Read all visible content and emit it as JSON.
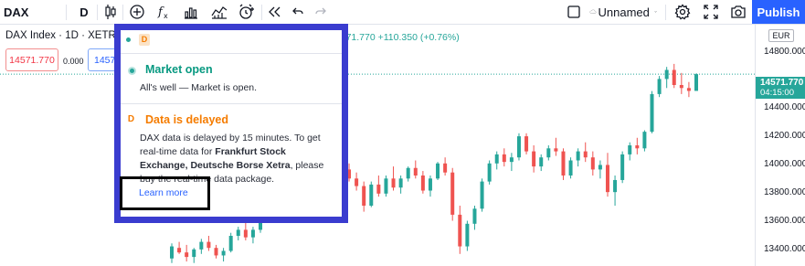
{
  "toolbar": {
    "symbol": "DAX",
    "interval": "D",
    "items": [
      "bar-style",
      "compare-add",
      "indicators",
      "financials",
      "templates",
      "alert",
      "replay",
      "undo",
      "redo"
    ],
    "layout_name": "Unnamed",
    "publish_label": "Publish"
  },
  "legend": {
    "title": "DAX Index · 1D · XETR",
    "ohlc": "O14519.720 H14576.600 L14511.300 C14571.770 +110.350 (+0.76%)",
    "sell_price": "14571.770",
    "spread": "0.000",
    "buy_price": "14571.770"
  },
  "popup": {
    "interval_badge": "D",
    "market": {
      "title": "Market open",
      "text": "All's well — Market is open."
    },
    "delay": {
      "badge": "D",
      "title": "Data is delayed",
      "text_pre": "DAX data is delayed by 15 minutes. To get real-time data for ",
      "text_bold": "Frankfurt Stock Exchange, Deutsche Borse Xetra",
      "text_post": ", please buy the real-time data package.",
      "link": "Learn more"
    }
  },
  "price_scale": {
    "currency": "EUR",
    "ticks": [
      "14800.000",
      "14400.000",
      "14200.000",
      "14000.000",
      "13800.000",
      "13600.000",
      "13400.000"
    ],
    "last_price": "14571.770",
    "countdown": "04:15:00"
  },
  "colors": {
    "up": "#26a69a",
    "down": "#ef5350",
    "accent": "#2962ff",
    "highlight_frame": "#3a3ccf"
  },
  "chart_data": {
    "type": "candlestick",
    "ylim": [
      13300,
      14900
    ],
    "candles": [
      [
        13350,
        13450,
        13320,
        13430
      ],
      [
        13420,
        13460,
        13380,
        13390
      ],
      [
        13390,
        13440,
        13330,
        13360
      ],
      [
        13360,
        13420,
        13320,
        13410
      ],
      [
        13410,
        13480,
        13380,
        13460
      ],
      [
        13460,
        13500,
        13400,
        13420
      ],
      [
        13420,
        13440,
        13350,
        13370
      ],
      [
        13370,
        13420,
        13330,
        13400
      ],
      [
        13400,
        13520,
        13390,
        13500
      ],
      [
        13500,
        13560,
        13470,
        13540
      ],
      [
        13540,
        13600,
        13470,
        13490
      ],
      [
        13490,
        13560,
        13450,
        13540
      ],
      [
        13540,
        13700,
        13520,
        13680
      ],
      [
        13680,
        13720,
        13600,
        13620
      ],
      [
        13620,
        13760,
        13600,
        13740
      ],
      [
        13740,
        13800,
        13680,
        13700
      ],
      [
        13700,
        13780,
        13650,
        13760
      ],
      [
        13760,
        13880,
        13720,
        13860
      ],
      [
        13860,
        13900,
        13800,
        13820
      ],
      [
        13820,
        13880,
        13760,
        13840
      ],
      [
        13840,
        13980,
        13820,
        13960
      ],
      [
        13960,
        13990,
        13820,
        13850
      ],
      [
        13850,
        13900,
        13780,
        13880
      ],
      [
        13880,
        13960,
        13840,
        13940
      ],
      [
        13940,
        13980,
        13860,
        13880
      ],
      [
        13880,
        13920,
        13800,
        13830
      ],
      [
        13830,
        13860,
        13660,
        13700
      ],
      [
        13700,
        13860,
        13690,
        13840
      ],
      [
        13840,
        13900,
        13760,
        13780
      ],
      [
        13780,
        13900,
        13760,
        13880
      ],
      [
        13880,
        13960,
        13800,
        13820
      ],
      [
        13820,
        13900,
        13780,
        13880
      ],
      [
        13880,
        13960,
        13860,
        13950
      ],
      [
        13950,
        14000,
        13880,
        13900
      ],
      [
        13900,
        13930,
        13780,
        13800
      ],
      [
        13800,
        13900,
        13760,
        13880
      ],
      [
        13880,
        13990,
        13870,
        13980
      ],
      [
        13980,
        14020,
        13900,
        13920
      ],
      [
        13920,
        13950,
        13600,
        13640
      ],
      [
        13640,
        13700,
        13380,
        13430
      ],
      [
        13430,
        13600,
        13400,
        13580
      ],
      [
        13580,
        13700,
        13540,
        13680
      ],
      [
        13680,
        13880,
        13660,
        13860
      ],
      [
        13860,
        14000,
        13840,
        13980
      ],
      [
        13980,
        14060,
        13940,
        14040
      ],
      [
        14040,
        14080,
        13960,
        13990
      ],
      [
        13990,
        14050,
        13930,
        14020
      ],
      [
        14020,
        14180,
        14000,
        14160
      ],
      [
        14160,
        14180,
        14040,
        14060
      ],
      [
        14060,
        14100,
        13920,
        13960
      ],
      [
        13960,
        14040,
        13930,
        14020
      ],
      [
        14020,
        14100,
        14000,
        14080
      ],
      [
        14080,
        14150,
        14030,
        14060
      ],
      [
        14060,
        14080,
        13870,
        13900
      ],
      [
        13900,
        14020,
        13880,
        14000
      ],
      [
        14000,
        14080,
        13960,
        14060
      ],
      [
        14060,
        14120,
        13990,
        14020
      ],
      [
        14020,
        14060,
        13900,
        13940
      ],
      [
        13940,
        14000,
        13880,
        13970
      ],
      [
        13970,
        14050,
        13760,
        13790
      ],
      [
        13790,
        13900,
        13700,
        13870
      ],
      [
        13870,
        14060,
        13850,
        14040
      ],
      [
        14040,
        14120,
        14000,
        14100
      ],
      [
        14100,
        14150,
        14040,
        14080
      ],
      [
        14080,
        14200,
        14060,
        14190
      ],
      [
        14190,
        14460,
        14180,
        14440
      ],
      [
        14440,
        14560,
        14420,
        14540
      ],
      [
        14540,
        14620,
        14480,
        14600
      ],
      [
        14600,
        14640,
        14480,
        14500
      ],
      [
        14500,
        14580,
        14440,
        14480
      ],
      [
        14480,
        14520,
        14420,
        14461
      ],
      [
        14461,
        14577,
        14511,
        14572
      ]
    ]
  }
}
